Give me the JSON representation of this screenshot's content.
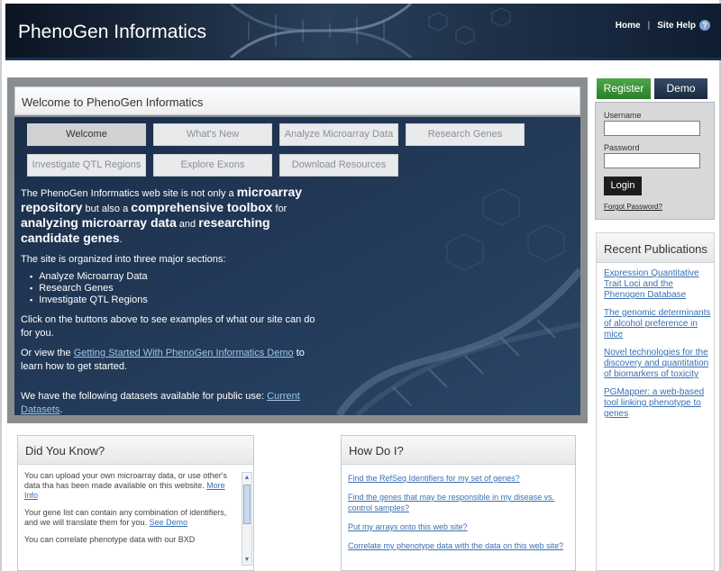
{
  "header": {
    "title": "PhenoGen Informatics",
    "home_link": "Home",
    "separator": "|",
    "help_link": "Site Help",
    "help_icon": "?"
  },
  "welcome": {
    "title": "Welcome to PhenoGen Informatics",
    "nav": [
      "Welcome",
      "What's New",
      "Analyze Microarray Data",
      "Research Genes",
      "Investigate QTL Regions",
      "Explore Exons",
      "Download Resources"
    ],
    "intro_1": "The PhenoGen Informatics web site is not only a ",
    "intro_2": "microarray repository",
    "intro_3": " but also a ",
    "intro_4": "comprehensive toolbox",
    "intro_5": " for ",
    "intro_6": "analyzing microarray data",
    "intro_7": " and ",
    "intro_8": "researching candidate genes",
    "intro_9": ".",
    "sections_intro": "The site is organized into three major sections:",
    "sections": [
      "Analyze Microarray Data",
      "Research Genes",
      "Investigate QTL Regions"
    ],
    "click_text": "Click on the buttons above to see examples of what our site can do for you.",
    "demo_prefix": "Or view the ",
    "demo_link": "Getting Started With PhenoGen Informatics Demo",
    "demo_suffix": " to learn how to get started.",
    "datasets_prefix": "We have the following datasets available for public use:  ",
    "datasets_link": "Current Datasets",
    "datasets_suffix": "."
  },
  "login": {
    "register": "Register",
    "demo": "Demo",
    "username_label": "Username",
    "password_label": "Password",
    "login_button": "Login",
    "forgot": "Forgot Password?"
  },
  "publications": {
    "title": "Recent Publications",
    "items": [
      "Expression Quantitative Trait Loci and the Phenogen Database",
      "The genomic determinants of alcohol preference in mice",
      "Novel technologies for the discovery and quantitation of biomarkers of toxicity",
      "PGMapper: a web-based tool linking phenotype to genes"
    ]
  },
  "did_you_know": {
    "title": "Did You Know?",
    "tip1_text": "You can upload your own microarray data, or use other's data tha has been made available on this website. ",
    "tip1_link": "More Info",
    "tip2_text": "Your gene list can contain any combination of identifiers, and we will translate them for you. ",
    "tip2_link": "See Demo",
    "tip3_text": "You can correlate phenotype data with our BXD"
  },
  "how_do_i": {
    "title": "How Do I?",
    "items": [
      "Find the RefSeq Identifiers for my set of genes?",
      "Find the genes that may be responsible in my disease vs. control samples?",
      "Put my arrays onto this web site?",
      "Correlate my phenotype data with the data on this web site?"
    ]
  },
  "colors": {
    "header_bg": "#0f1a2a",
    "panel_dark": "#1f3552",
    "register_green": "#3a9338",
    "link_blue": "#3a6fb2"
  }
}
